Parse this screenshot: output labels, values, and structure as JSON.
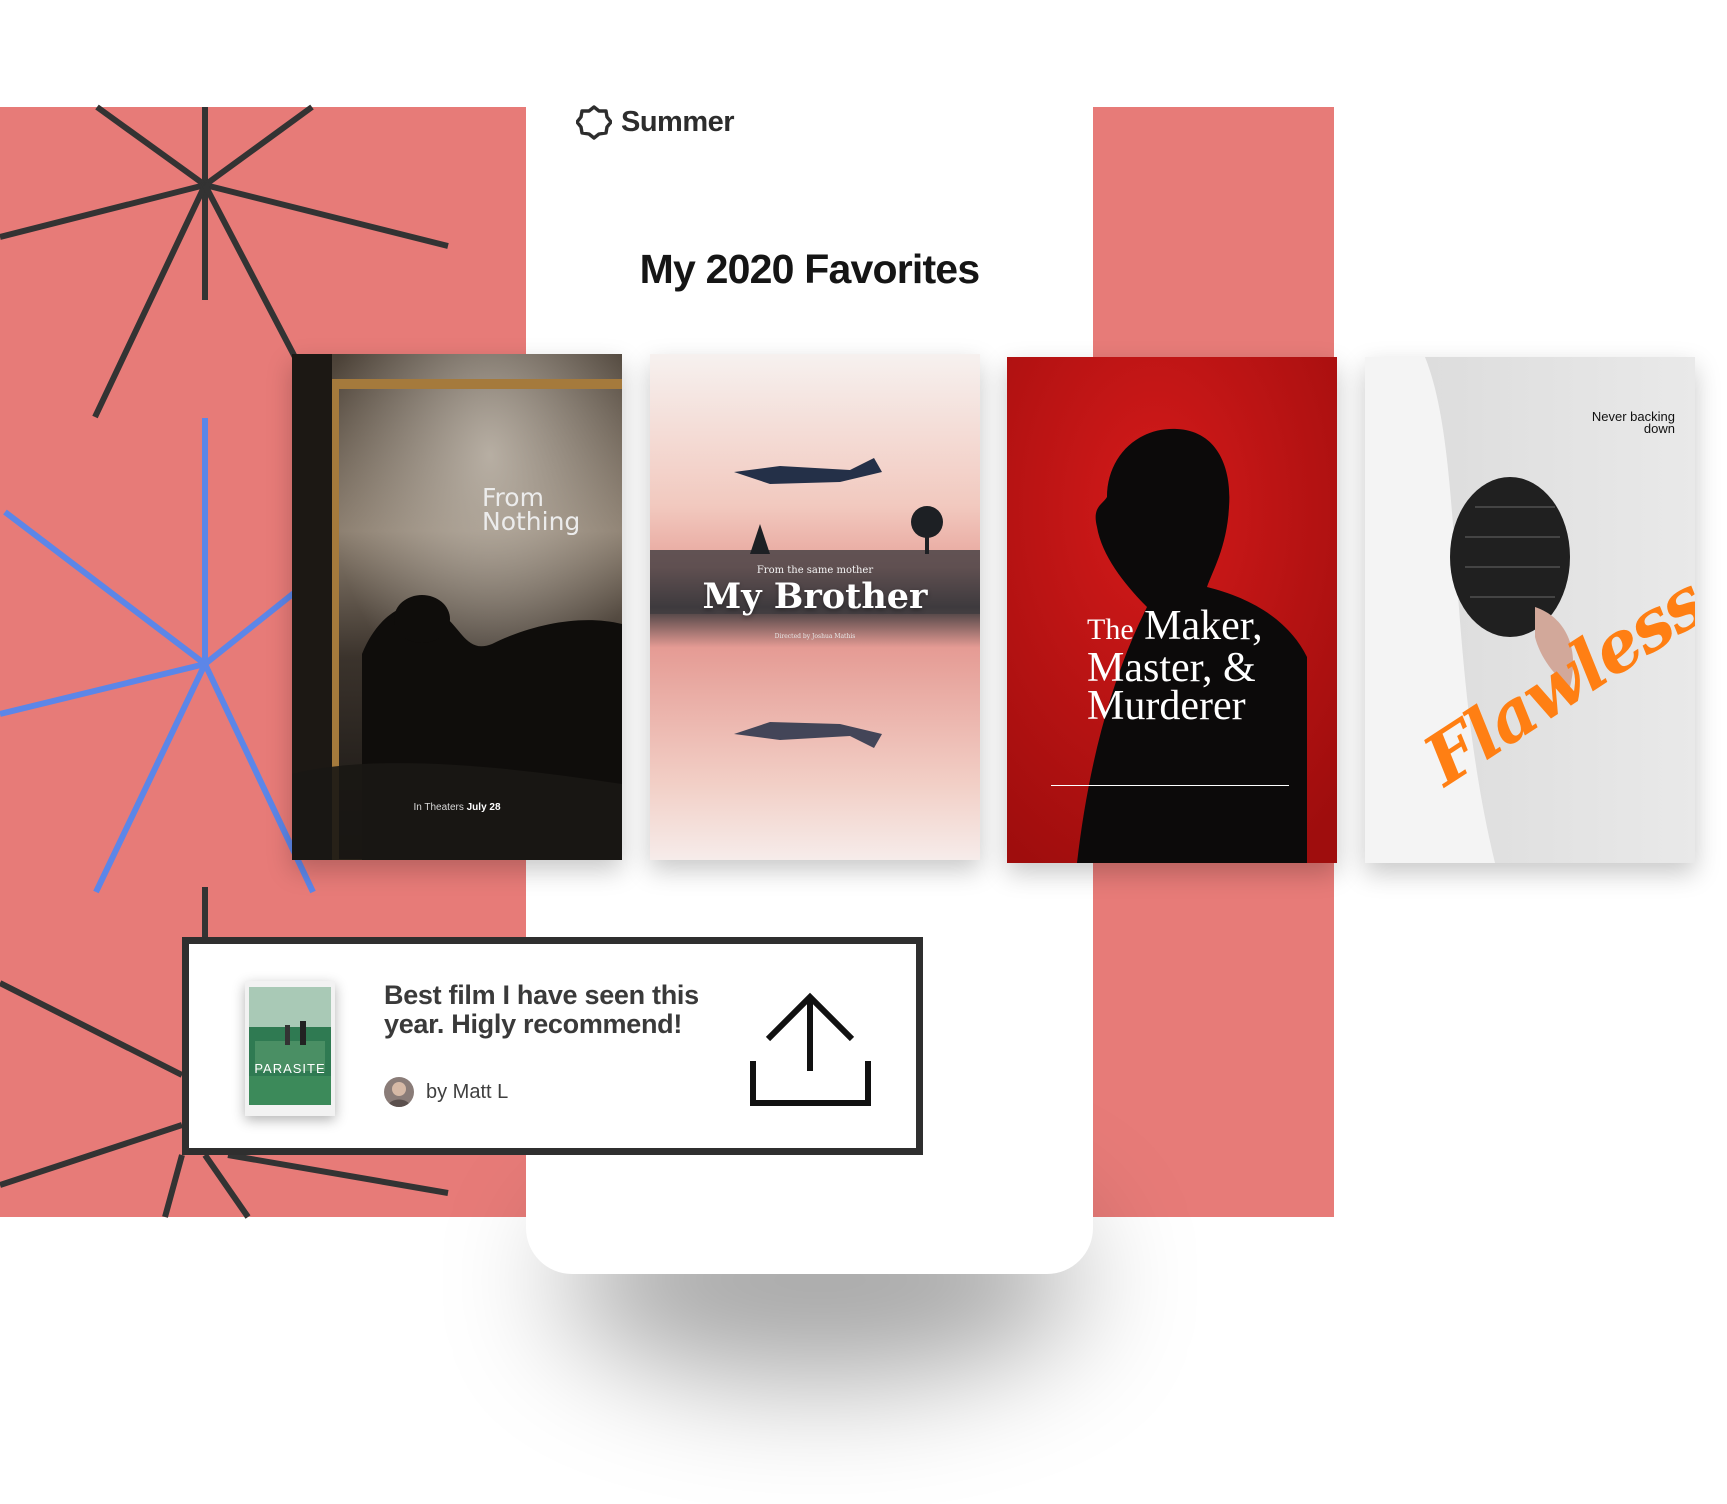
{
  "app": {
    "name": "Summer"
  },
  "page": {
    "title": "My 2020 Favorites"
  },
  "posters": [
    {
      "title": "From Nothing",
      "release_prefix": "In Theaters",
      "release_date": "July 28"
    },
    {
      "tagline": "From the same mother",
      "title": "My Brother",
      "credit": "Directed by Joshua Mathis"
    },
    {
      "title_the": "The",
      "title_rest": "Maker, Master, & Murderer"
    },
    {
      "tagline": "Never backing down",
      "title": "Flawless"
    }
  ],
  "review": {
    "film": "PARASITE",
    "text": "Best film I have seen this year. Higly recommend!",
    "author": "by Matt L"
  },
  "colors": {
    "background_panel": "#e77b78",
    "star_dark": "#333333",
    "star_blue": "#5c86e8",
    "flawless_title": "#ff7f13",
    "poster_3_bg": "#c11414"
  },
  "icons": {
    "logo": "flower-logo-icon",
    "share": "share-icon"
  }
}
